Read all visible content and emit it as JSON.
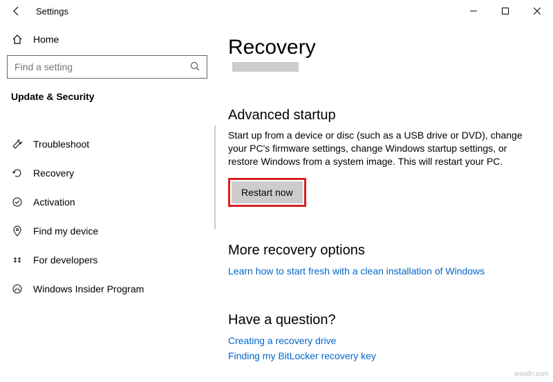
{
  "window": {
    "title": "Settings"
  },
  "sidebar": {
    "home_label": "Home",
    "search_placeholder": "Find a setting",
    "section_label": "Update & Security",
    "items": [
      {
        "label": "Troubleshoot"
      },
      {
        "label": "Recovery"
      },
      {
        "label": "Activation"
      },
      {
        "label": "Find my device"
      },
      {
        "label": "For developers"
      },
      {
        "label": "Windows Insider Program"
      }
    ]
  },
  "main": {
    "page_title": "Recovery",
    "advanced": {
      "heading": "Advanced startup",
      "desc": "Start up from a device or disc (such as a USB drive or DVD), change your PC's firmware settings, change Windows startup settings, or restore Windows from a system image. This will restart your PC.",
      "button": "Restart now"
    },
    "more": {
      "heading": "More recovery options",
      "link": "Learn how to start fresh with a clean installation of Windows"
    },
    "question": {
      "heading": "Have a question?",
      "link1": "Creating a recovery drive",
      "link2": "Finding my BitLocker recovery key"
    }
  },
  "watermark": "wsxdn.com"
}
